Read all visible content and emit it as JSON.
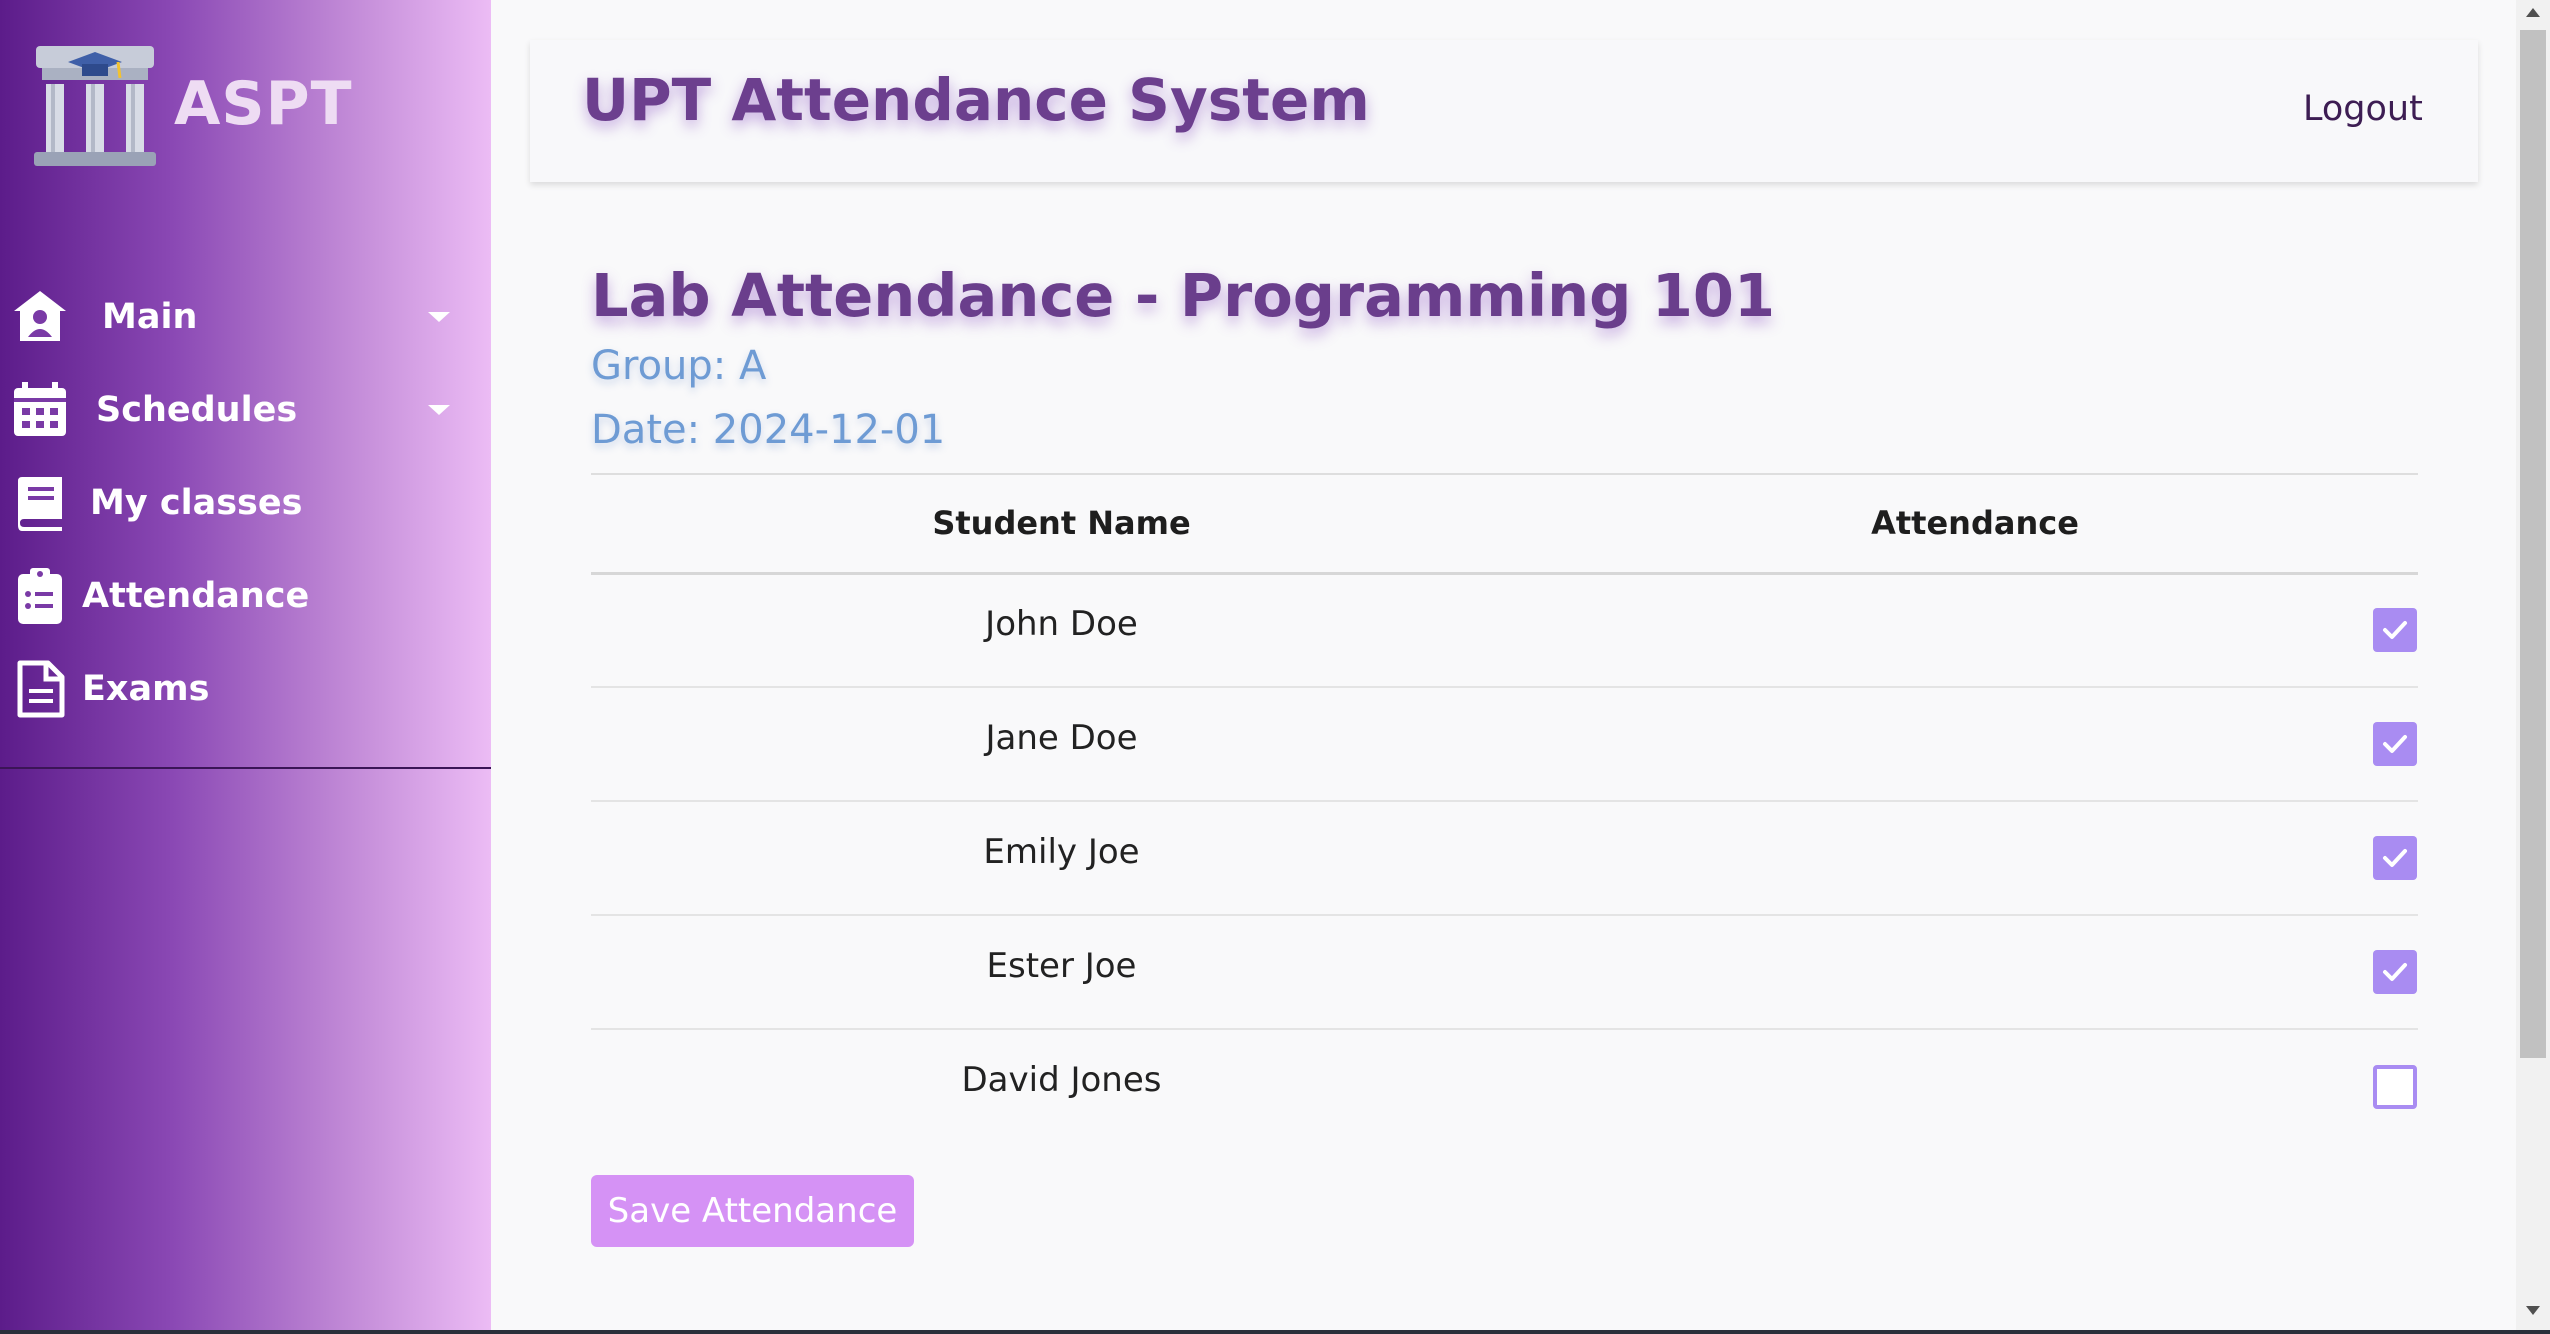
{
  "brand": {
    "name": "ASPT",
    "logo_icon": "university-building-icon"
  },
  "sidebar": {
    "items": [
      {
        "label": "Main",
        "icon": "home-user-icon",
        "has_dropdown": true
      },
      {
        "label": "Schedules",
        "icon": "calendar-icon",
        "has_dropdown": true
      },
      {
        "label": "My classes",
        "icon": "book-icon",
        "has_dropdown": false
      },
      {
        "label": "Attendance",
        "icon": "clipboard-list-icon",
        "has_dropdown": false
      },
      {
        "label": "Exams",
        "icon": "document-icon",
        "has_dropdown": false
      }
    ]
  },
  "header": {
    "title": "UPT Attendance System",
    "logout_label": "Logout"
  },
  "main": {
    "title": "Lab Attendance - Programming 101",
    "group_text": "Group: A",
    "date_text": "Date: 2024-12-01",
    "table": {
      "columns": [
        "Student Name",
        "Attendance"
      ],
      "rows": [
        {
          "name": "John Doe",
          "present": true
        },
        {
          "name": "Jane Doe",
          "present": true
        },
        {
          "name": "Emily Joe",
          "present": true
        },
        {
          "name": "Ester Joe",
          "present": true
        },
        {
          "name": "David Jones",
          "present": false
        }
      ]
    },
    "save_label": "Save Attendance"
  },
  "colors": {
    "accent_purple": "#6a3e8c",
    "meta_blue": "#6e9bd4",
    "checkbox": "#a98cf2",
    "save_button": "#d592f5"
  }
}
